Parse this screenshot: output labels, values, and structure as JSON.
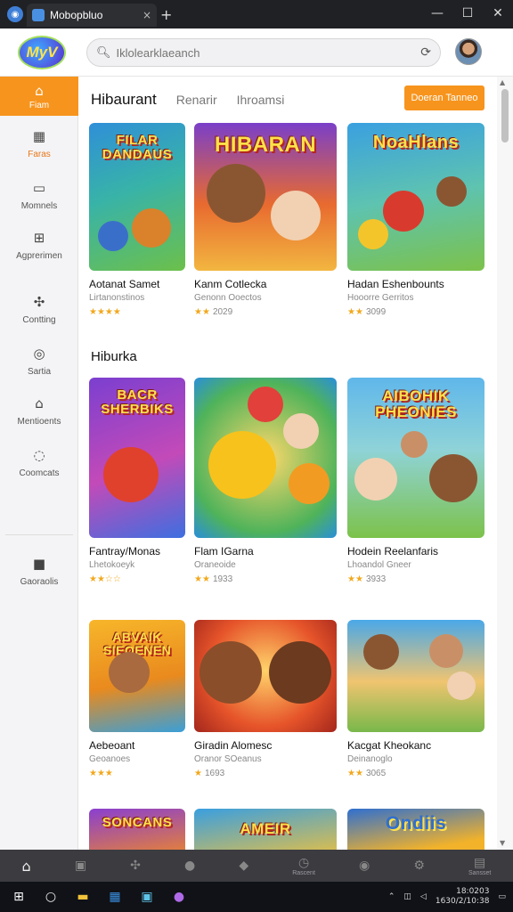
{
  "window": {
    "tab_title": "Mobopbluo",
    "tab_close": "×",
    "new_tab": "+",
    "minimize": "—",
    "maximize": "☐",
    "close": "✕"
  },
  "header": {
    "logo_text": "MyV",
    "search_placeholder": "Iklolearklaeanch"
  },
  "sidebar": {
    "items": [
      {
        "label": "Fiam",
        "icon": "home-icon"
      },
      {
        "label": "Faras",
        "icon": "grid-icon"
      },
      {
        "label": "Momnels",
        "icon": "folder-icon"
      },
      {
        "label": "Agprerimen",
        "icon": "plus-square-icon"
      },
      {
        "label": "Contting",
        "icon": "puzzle-icon"
      },
      {
        "label": "Sartia",
        "icon": "circle-icon"
      },
      {
        "label": "Mentioents",
        "icon": "gamepad-icon"
      },
      {
        "label": "Coomcats",
        "icon": "chat-icon"
      },
      {
        "label": "Gaoraolis",
        "icon": "bag-icon"
      }
    ]
  },
  "main": {
    "categories": [
      "Hibaurant",
      "Renarir",
      "Ihroamsi"
    ],
    "top_button": "Doeran Tanneo",
    "section2_title": "Hiburka"
  },
  "cards": [
    {
      "title": "Aotanat Samet",
      "sub": "Lirtanonstinos",
      "stars": "★★★★",
      "meta": "",
      "art": "FILAR DANDAUS"
    },
    {
      "title": "Kanm Cotlecka",
      "sub": "Genonn Ooectos",
      "stars": "★★",
      "meta": "2029",
      "art": "HIBARAN"
    },
    {
      "title": "Hadan Eshenbounts",
      "sub": "Hooorre Gerritos",
      "stars": "★★",
      "meta": "3099",
      "art": "NoaHlans"
    },
    {
      "title": "Fantray/Monas",
      "sub": "Lhetokoeyk",
      "stars": "★★☆☆",
      "meta": "",
      "art": "BACR SHERBIKS"
    },
    {
      "title": "Flam IGarna",
      "sub": "Oraneoide",
      "stars": "★★",
      "meta": "1933",
      "art": ""
    },
    {
      "title": "Hodein Reelanfaris",
      "sub": "Lhoandol Gneer",
      "stars": "★★",
      "meta": "3933",
      "art": "AIBOHIK PHEONIES"
    },
    {
      "title": "Aebeoant",
      "sub": "Geoanoes",
      "stars": "★★★",
      "meta": "",
      "art": "ABVAIK SIEOENEN"
    },
    {
      "title": "Giradin Alomesc",
      "sub": "Oranor SOeanus",
      "stars": "★",
      "meta": "1693",
      "art": ""
    },
    {
      "title": "Kacgat Kheokanc",
      "sub": "Deinanoglo",
      "stars": "★★",
      "meta": "3065",
      "art": ""
    },
    {
      "title": "",
      "sub": "",
      "stars": "",
      "meta": "",
      "art": "SONCANS"
    },
    {
      "title": "",
      "sub": "",
      "stars": "",
      "meta": "",
      "art": "AMEIR"
    },
    {
      "title": "",
      "sub": "",
      "stars": "",
      "meta": "",
      "art": "Ondiis"
    }
  ],
  "bottom_nav": [
    "",
    "",
    "",
    "",
    "",
    "Rascent",
    "",
    "",
    "Sansset"
  ],
  "taskbar": {
    "clock_time": "18:0203",
    "clock_date": "1630/2/10:38"
  },
  "colors": {
    "accent": "#f7941d",
    "star": "#f2a81d"
  }
}
